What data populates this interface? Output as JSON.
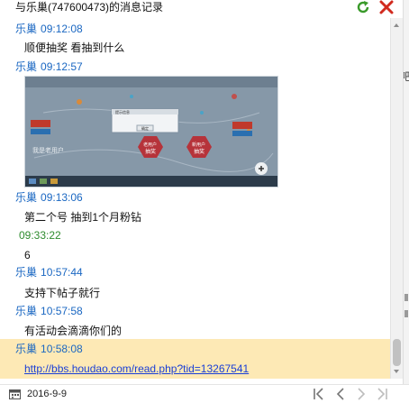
{
  "window": {
    "title": "与乐巢(747600473)的消息记录",
    "colors": {
      "sender": "#1a67c2",
      "highlight": "#fde9b5",
      "link": "#1a3fd6",
      "time_only": "#2e8b2e"
    }
  },
  "messages": [
    {
      "sender": "乐巢",
      "time": "09:12:08",
      "text": "顺便抽奖 看抽到什么"
    },
    {
      "sender": "乐巢",
      "time": "09:12:57",
      "image": "screenshot-thumbnail"
    },
    {
      "sender": "乐巢",
      "time": "09:13:06",
      "text": "第二个号 抽到1个月粉钻"
    },
    {
      "time": "09:33:22",
      "text": "6"
    },
    {
      "sender": "乐巢",
      "time": "10:57:44",
      "text": "支持下帖子就行"
    },
    {
      "sender": "乐巢",
      "time": "10:57:58",
      "text": "有活动会滴滴你们的"
    },
    {
      "sender": "乐巢",
      "time": "10:58:08",
      "link": "http://bbs.houdao.com/read.php?tid=13267541"
    }
  ],
  "thumbnail": {
    "dialog_title": "提示信息",
    "dialog_ok": "确定",
    "left_label": "我是老用户",
    "badge_1_line1": "老用户",
    "badge_1_line2": "抽奖",
    "badge_2_line1": "新用户",
    "badge_2_line2": "抽奖"
  },
  "right_panel": {
    "fragment": "吧"
  },
  "footer": {
    "date": "2016-9-9"
  },
  "icons": [
    "refresh-icon",
    "close-icon",
    "calendar-icon",
    "first-page-icon",
    "prev-page-icon",
    "next-page-icon",
    "last-page-icon",
    "zoom-icon"
  ]
}
